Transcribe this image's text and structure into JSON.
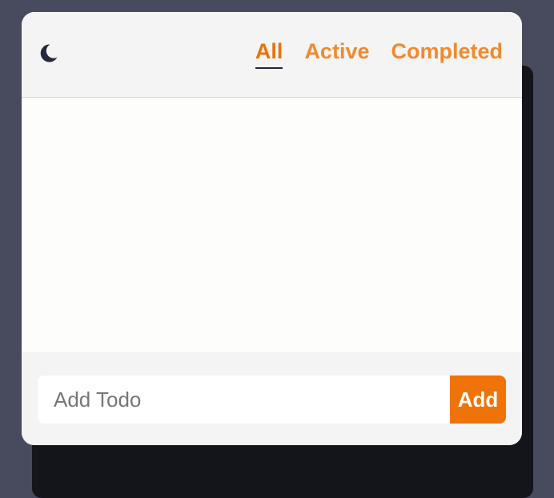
{
  "header": {
    "theme_toggle_icon": "moon-icon",
    "filters": [
      {
        "label": "All",
        "active": true
      },
      {
        "label": "Active",
        "active": false
      },
      {
        "label": "Completed",
        "active": false
      }
    ]
  },
  "todo_list": {
    "items": []
  },
  "footer": {
    "input_placeholder": "Add Todo",
    "input_value": "",
    "add_label": "Add"
  },
  "colors": {
    "accent": "#ef7307",
    "tab_text": "#f08a2e",
    "active_underline": "#22253a",
    "background": "#484b5e",
    "card": "#f4f4f4",
    "list_background": "#fdfefc"
  }
}
